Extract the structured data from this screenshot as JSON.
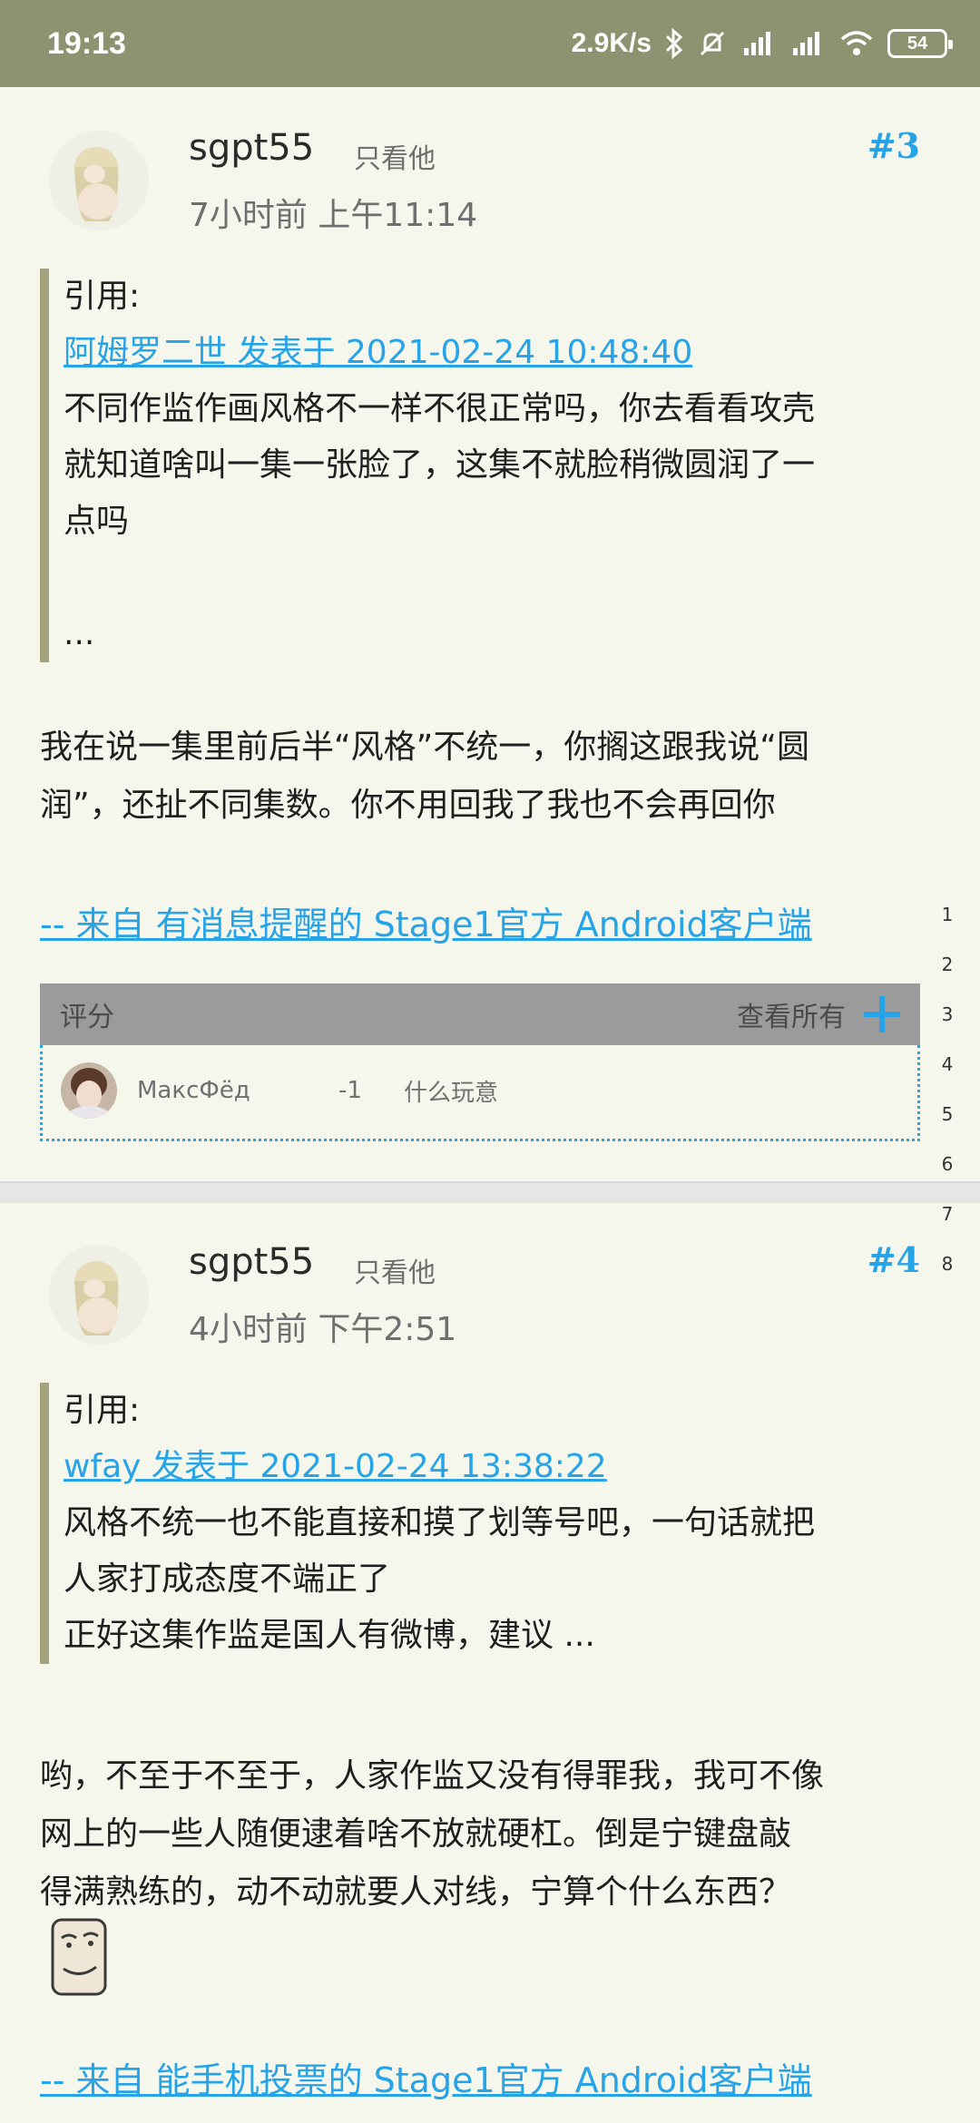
{
  "status_bar": {
    "time": "19:13",
    "speed": "2.9K/s",
    "battery": "54"
  },
  "posts": [
    {
      "username": "sgpt55",
      "only_him": "只看他",
      "floor": "#3",
      "time": "7小时前 上午11:14",
      "quote": {
        "label": "引用:",
        "link": "阿姆罗二世 发表于 2021-02-24 10:48:40",
        "lines": [
          "不同作监作画风格不一样不很正常吗，你去看看攻壳",
          "就知道啥叫一集一张脸了，这集不就脸稍微圆润了一",
          "点吗",
          "",
          "..."
        ]
      },
      "body": [
        "我在说一集里前后半“风格”不统一，你搁这跟我说“圆",
        "润”，还扯不同集数。你不用回我了我也不会再回你"
      ],
      "source": " -- 来自 有消息提醒的 Stage1官方 Android客户端",
      "rating": {
        "header": "评分",
        "view_all": "查看所有",
        "entries": [
          {
            "user": "МаксФёд",
            "score": "-1",
            "comment": "什么玩意"
          }
        ]
      }
    },
    {
      "username": "sgpt55",
      "only_him": "只看他",
      "floor": "#4",
      "time": "4小时前 下午2:51",
      "quote": {
        "label": "引用:",
        "link": "wfay 发表于 2021-02-24 13:38:22",
        "lines": [
          "风格不统一也不能直接和摸了划等号吧，一句话就把",
          "人家打成态度不端正了",
          "正好这集作监是国人有微博，建议 ..."
        ]
      },
      "body": [
        "哟，不至于不至于，人家作监又没有得罪我，我可不像",
        "网上的一些人随便逮着啥不放就硬杠。倒是宁键盘敲",
        "得满熟练的，动不动就要人对线，宁算个什么东西？"
      ],
      "source": " -- 来自 能手机投票的 Stage1官方 Android客户端"
    }
  ],
  "line_numbers": [
    "1",
    "2",
    "3",
    "4",
    "5",
    "6",
    "7",
    "8"
  ],
  "colors": {
    "accent": "#27a3e8",
    "status_bar": "#8f9270",
    "quote_bar": "#a3a47d",
    "background": "#f6f7ec"
  }
}
